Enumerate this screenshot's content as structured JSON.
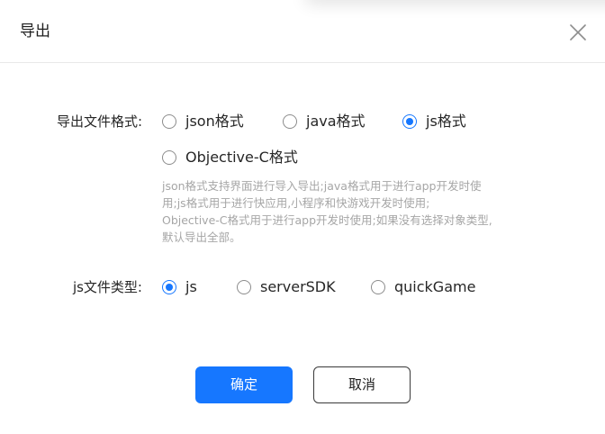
{
  "dialog": {
    "title": "导出",
    "close_icon": "close-icon"
  },
  "format": {
    "label": "导出文件格式:",
    "options": [
      {
        "label": "json格式",
        "checked": false
      },
      {
        "label": "java格式",
        "checked": false
      },
      {
        "label": "js格式",
        "checked": true
      },
      {
        "label": "Objective-C格式",
        "checked": false
      }
    ],
    "help_lines": [
      "json格式支持界面进行导入导出;java格式用于进行app开发时使",
      "用;js格式用于进行快应用,小程序和快游戏开发时使用;",
      "Objective-C格式用于进行app开发时使用;如果没有选择对象类型,",
      "默认导出全部。"
    ]
  },
  "js_type": {
    "label": "js文件类型:",
    "options": [
      {
        "label": "js",
        "checked": true
      },
      {
        "label": "serverSDK",
        "checked": false
      },
      {
        "label": "quickGame",
        "checked": false
      }
    ]
  },
  "footer": {
    "confirm_label": "确定",
    "cancel_label": "取消"
  },
  "colors": {
    "primary": "#1677ff",
    "help_text": "#a6a6a6",
    "divider": "#e8e8e8"
  }
}
